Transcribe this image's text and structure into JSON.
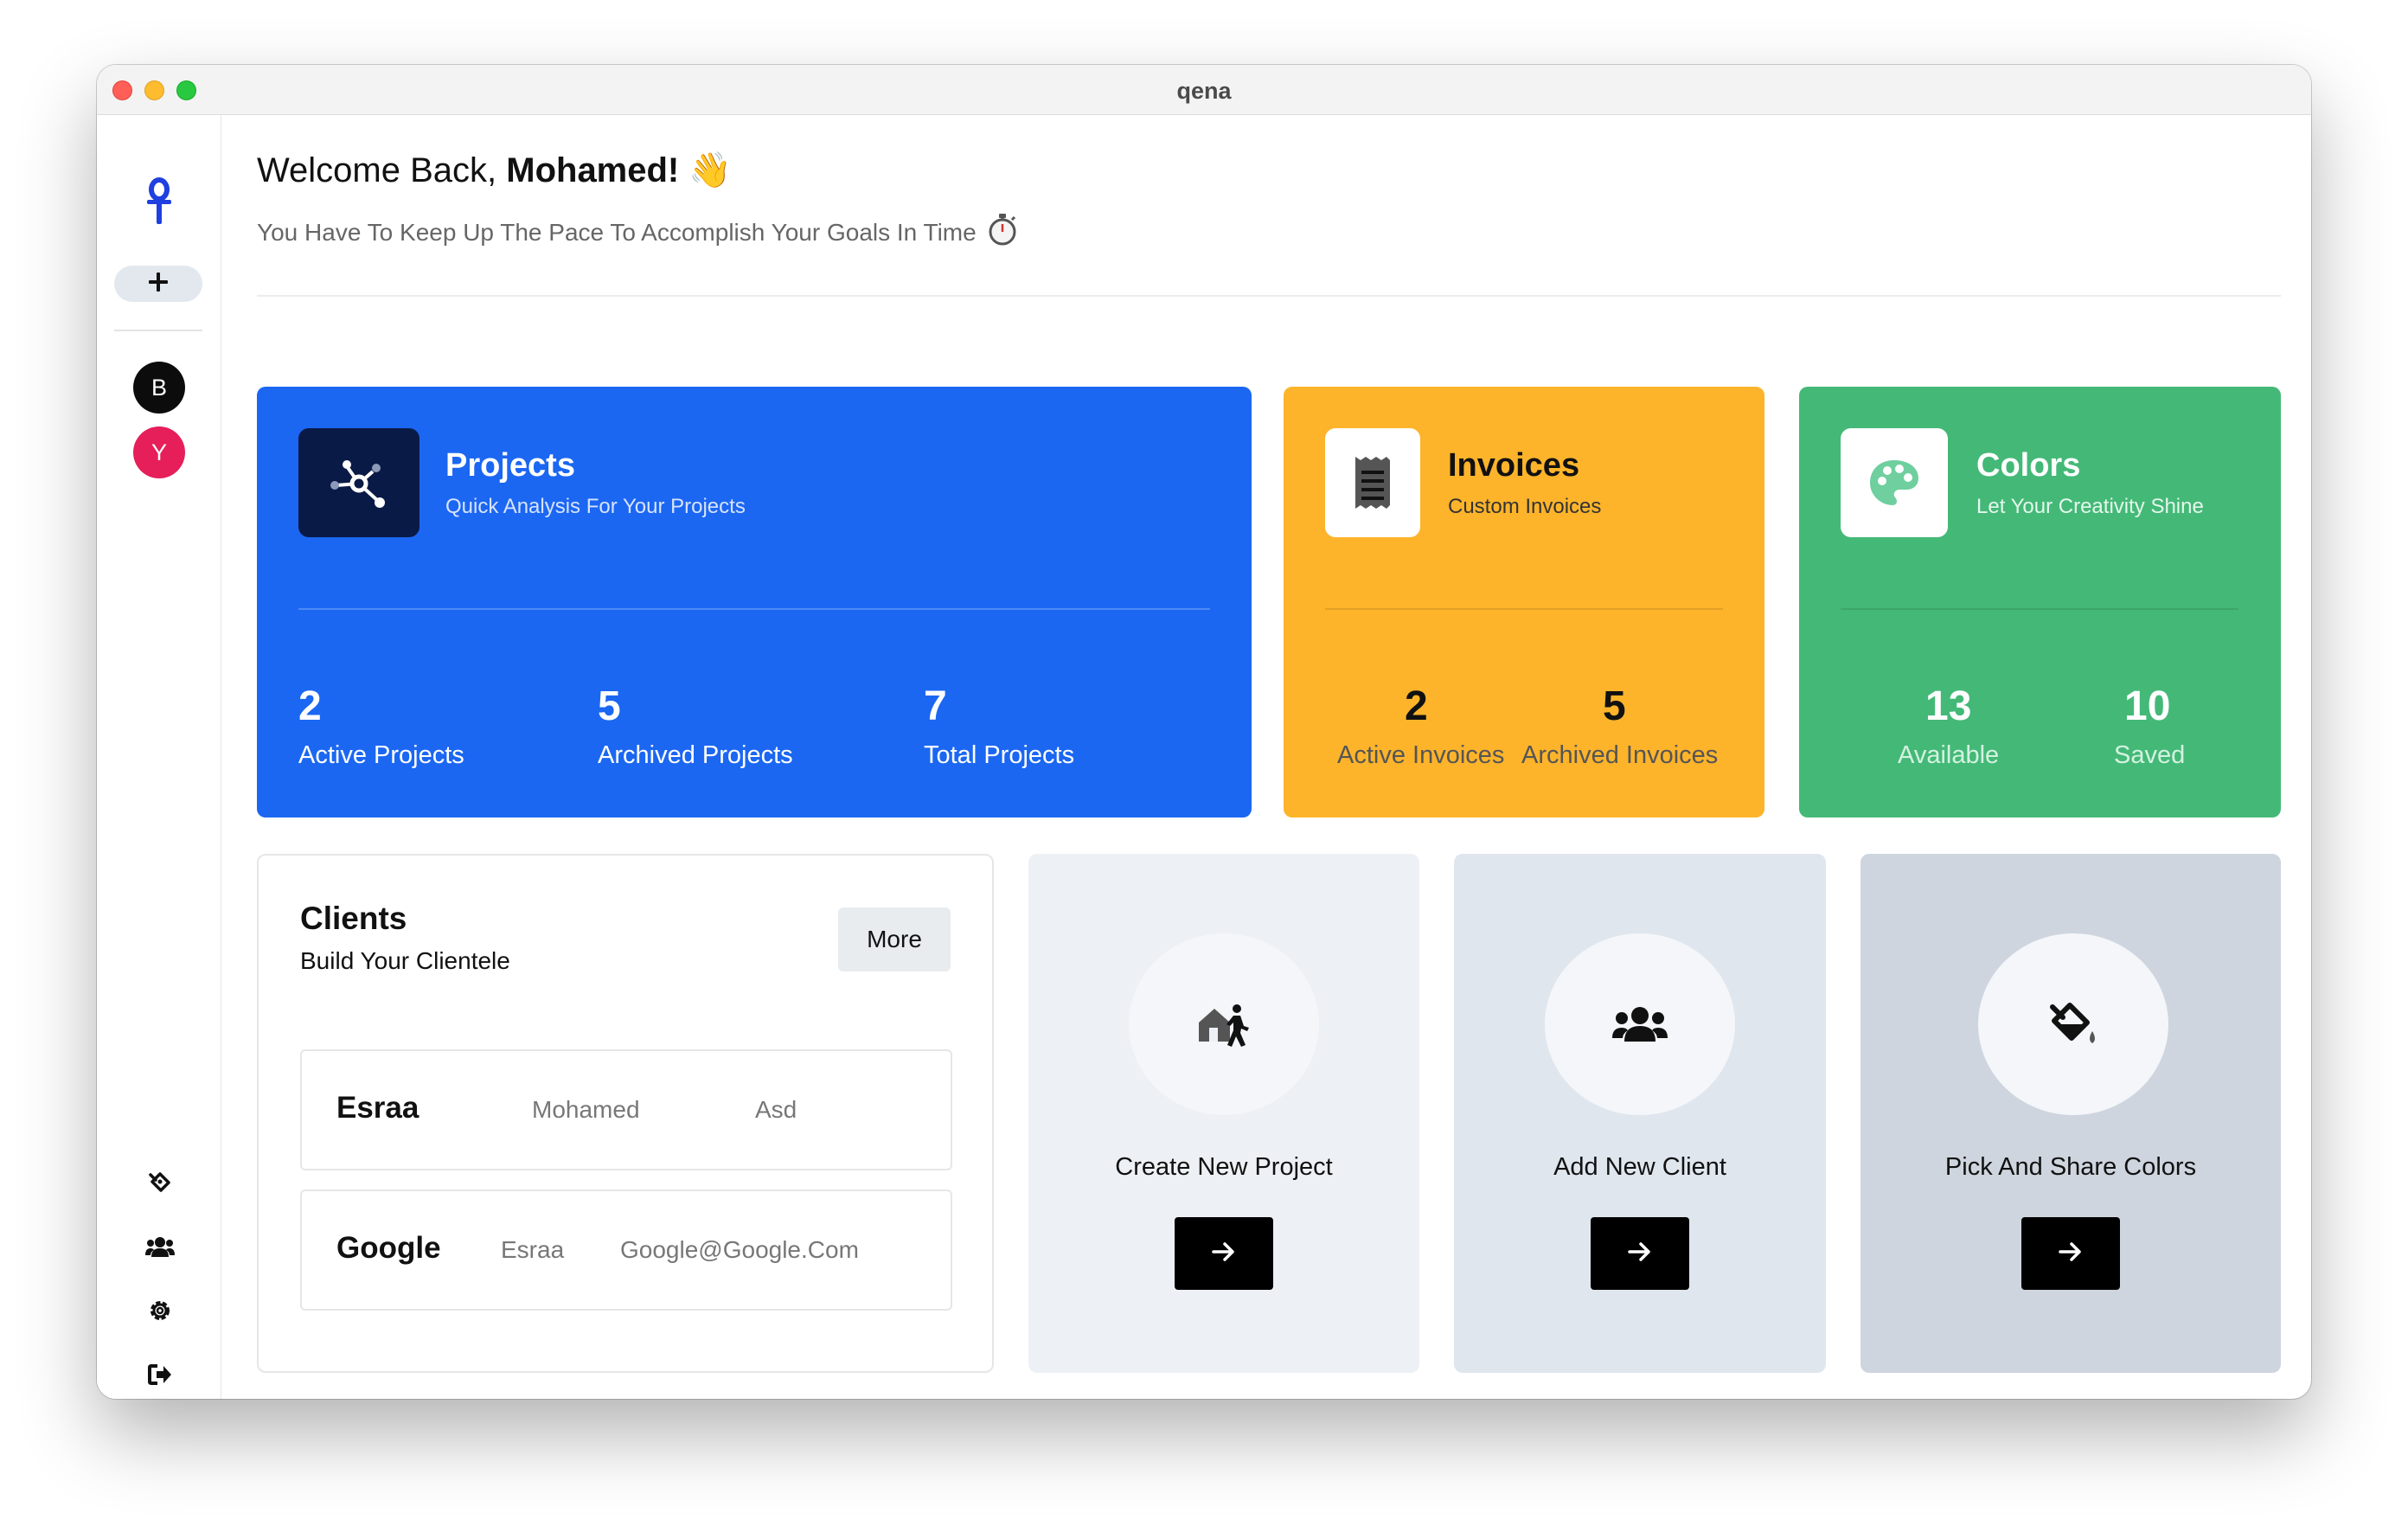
{
  "window": {
    "title": "qena"
  },
  "sidebar": {
    "logo_icon": "ankh-logo-icon",
    "add_icon": "plus-icon",
    "workspaces": [
      {
        "initial": "B",
        "color": "#0c0c0c"
      },
      {
        "initial": "Y",
        "color": "#e61e5a"
      }
    ],
    "bottom_icons": [
      "color-bucket-icon",
      "users-icon",
      "gear-icon",
      "sign-out-icon"
    ]
  },
  "header": {
    "welcome_prefix": "Welcome Back, ",
    "welcome_name": "Mohamed!",
    "welcome_emoji": "👋",
    "subtitle": "You Have To Keep Up The Pace To Accomplish Your Goals In Time",
    "subtitle_icon": "stopwatch-icon"
  },
  "cards": {
    "projects": {
      "title": "Projects",
      "subtitle": "Quick Analysis For Your Projects",
      "icon": "network-icon",
      "color": "#1b67f2",
      "stats": [
        {
          "value": "2",
          "label": "Active Projects"
        },
        {
          "value": "5",
          "label": "Archived Projects"
        },
        {
          "value": "7",
          "label": "Total Projects"
        }
      ]
    },
    "invoices": {
      "title": "Invoices",
      "subtitle": "Custom Invoices",
      "icon": "receipt-icon",
      "color": "#fdb42b",
      "stats": [
        {
          "value": "2",
          "label": "Active Invoices"
        },
        {
          "value": "5",
          "label": "Archived Invoices"
        }
      ]
    },
    "colors": {
      "title": "Colors",
      "subtitle": "Let Your Creativity Shine",
      "icon": "palette-icon",
      "color": "#44b977",
      "stats": [
        {
          "value": "13",
          "label": "Available"
        },
        {
          "value": "10",
          "label": "Saved"
        }
      ]
    }
  },
  "clients": {
    "title": "Clients",
    "subtitle": "Build Your Clientele",
    "more_label": "More",
    "rows": [
      {
        "name": "Esraa",
        "col1": "Mohamed",
        "col2": "Asd"
      },
      {
        "name": "Google",
        "col1": "Esraa",
        "col2": "Google@Google.Com"
      }
    ]
  },
  "actions": [
    {
      "label": "Create New Project",
      "icon": "house-person-icon"
    },
    {
      "label": "Add New Client",
      "icon": "users-icon"
    },
    {
      "label": "Pick And Share Colors",
      "icon": "fill-drip-icon"
    }
  ]
}
